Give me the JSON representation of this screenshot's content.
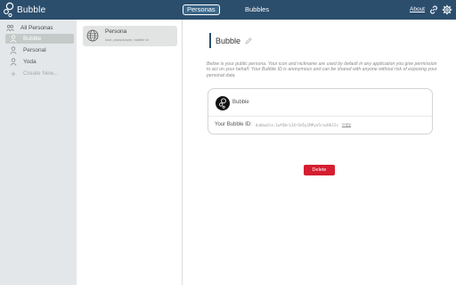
{
  "header": {
    "app_name": "Bubble",
    "tabs": [
      {
        "label": "Personas",
        "active": true
      },
      {
        "label": "Bubbles",
        "active": false
      }
    ],
    "about_label": "About",
    "icons": [
      "link-icon",
      "gear-icon"
    ],
    "colors": {
      "header_bg": "#2b4e6d",
      "active_tab_bg": "#3c6688"
    }
  },
  "sidebar": {
    "items": [
      {
        "label": "All Personas",
        "icon": "people-icon",
        "selected": false
      },
      {
        "label": "Bubble",
        "icon": "user-icon",
        "selected": true
      },
      {
        "label": "Personal",
        "icon": "user-icon",
        "selected": false
      },
      {
        "label": "Yoda",
        "icon": "user-icon",
        "selected": false
      },
      {
        "label": "Create New...",
        "icon": "plus-icon",
        "selected": false
      }
    ]
  },
  "list": {
    "card": {
      "title": "Persona",
      "subtitle": "icon, pseudonym, bubble id",
      "icon": "globe-icon"
    }
  },
  "detail": {
    "title": "Bubble",
    "description": "Below is your public persona. Your icon and nickname are used by default in any application you give permission to act on your behalf. Your Bubble ID is anonymous and can be shared with anyone without risk of exposing your personal data.",
    "persona_name": "Bubble",
    "id_label": "Your Bubble ID:",
    "id_value": "dubbuble:1wfQbrL3XrSd5y1MPye5racKKJ2s",
    "copy_label": "copy",
    "delete_label": "Delete",
    "colors": {
      "delete": "#d51e31",
      "accent": "#2b4e6d"
    }
  }
}
